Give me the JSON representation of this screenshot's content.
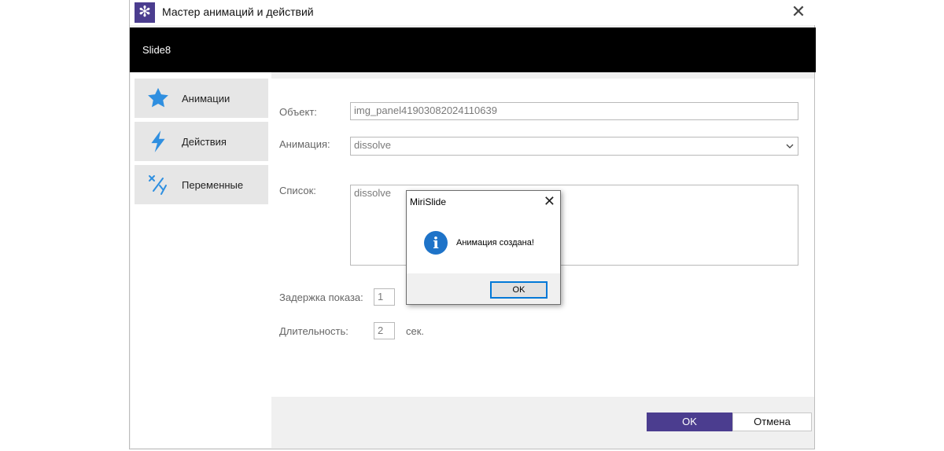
{
  "window": {
    "title": "Мастер анимаций и действий",
    "close_glyph": "✕"
  },
  "header": {
    "slide_name": "Slide8"
  },
  "sidebar": {
    "items": [
      {
        "label": "Анимации",
        "icon": "star-icon"
      },
      {
        "label": "Действия",
        "icon": "lightning-icon"
      },
      {
        "label": "Переменные",
        "icon": "variables-icon"
      }
    ]
  },
  "form": {
    "object_label": "Объект:",
    "object_value": "img_panel41903082024110639",
    "animation_label": "Анимация:",
    "animation_value": "dissolve",
    "list_label": "Список:",
    "list_items": [
      "dissolve"
    ],
    "delay_label": "Задержка показа:",
    "delay_value": "1",
    "duration_label": "Длительность:",
    "duration_value": "2",
    "duration_unit": "сек."
  },
  "footer": {
    "ok_label": "OK",
    "cancel_label": "Отмена"
  },
  "message_box": {
    "title": "MiriSlide",
    "close_glyph": "✕",
    "icon_glyph": "i",
    "text": "Анимация создана!",
    "ok_label": "OK"
  },
  "colors": {
    "accent": "#4b3d8f",
    "header_bg": "#000000",
    "info_icon": "#1e73c8",
    "icon_blue": "#2f8fe0"
  }
}
